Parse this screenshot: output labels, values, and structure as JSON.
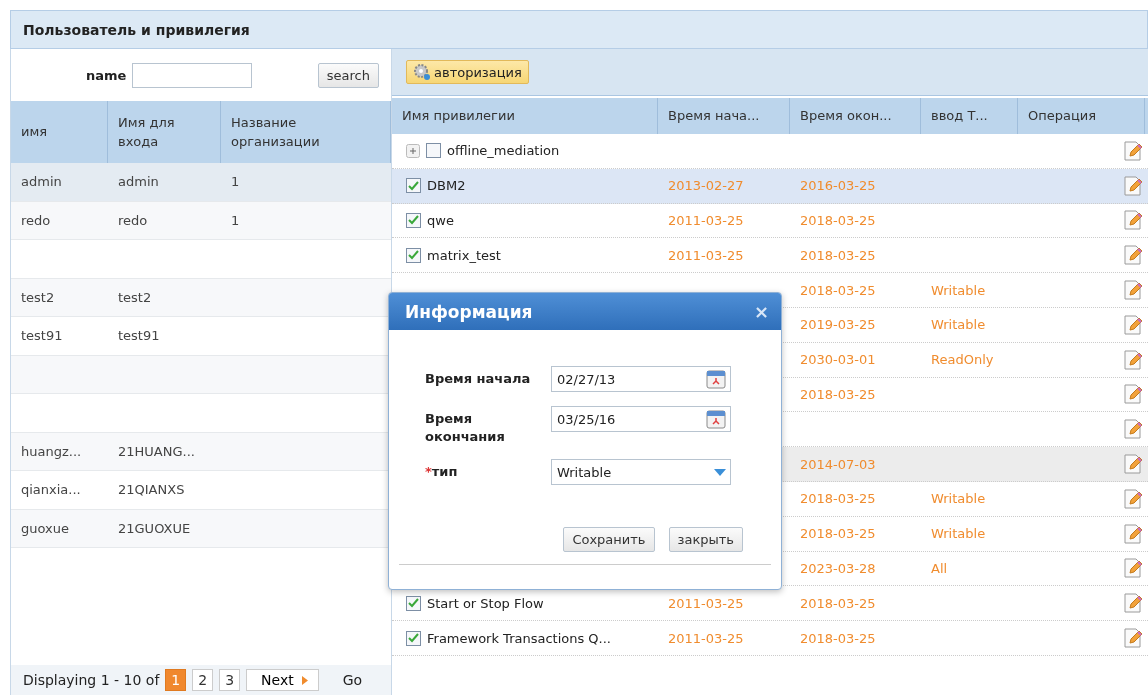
{
  "title": "Пользователь и привилегия",
  "search": {
    "label": "name",
    "button": "search"
  },
  "users": {
    "columns": [
      "имя",
      "Имя для входа",
      "Название организации"
    ],
    "rows": [
      {
        "cells": [
          "admin",
          "admin",
          "1"
        ],
        "selected": true
      },
      {
        "cells": [
          "redo",
          "redo",
          "1"
        ],
        "selected": false
      },
      {
        "cells": [],
        "selected": false
      },
      {
        "cells": [
          "test2",
          "test2"
        ],
        "selected": false
      },
      {
        "cells": [
          "test91",
          "test91"
        ],
        "selected": false
      },
      {
        "cells": [],
        "selected": false
      },
      {
        "cells": [],
        "selected": false
      },
      {
        "cells": [
          "huangz...",
          "21HUANG..."
        ],
        "selected": false
      },
      {
        "cells": [
          "qianxia...",
          "21QIANXS"
        ],
        "selected": false
      },
      {
        "cells": [
          "guoxue",
          "21GUOXUE"
        ],
        "selected": false
      }
    ]
  },
  "pager": {
    "summary": "Displaying 1 - 10 of",
    "pages": [
      {
        "label": "1",
        "selected": true
      },
      {
        "label": "2",
        "selected": false
      },
      {
        "label": "3",
        "selected": false
      }
    ],
    "next": "Next",
    "goto": "Go"
  },
  "toolbar": {
    "button": "авторизация"
  },
  "privileges": {
    "columns": [
      "Имя привилегии",
      "Время нача...",
      "Время окон...",
      "ввод Т...",
      "Операция"
    ],
    "rows": [
      {
        "name": "offline_mediation",
        "expandable": true,
        "checked": false,
        "selected": false
      },
      {
        "name": "DBM2",
        "checked": true,
        "start": "2013-02-27",
        "end": "2016-03-25",
        "selected": true
      },
      {
        "name": "qwe",
        "checked": true,
        "start": "2011-03-25",
        "end": "2018-03-25",
        "selected": false
      },
      {
        "name": "matrix_test",
        "checked": true,
        "start": "2011-03-25",
        "end": "2018-03-25",
        "selected": false
      },
      {
        "end": "2018-03-25",
        "type": "Writable",
        "selected": false
      },
      {
        "end": "2019-03-25",
        "type": "Writable",
        "selected": false
      },
      {
        "end": "2030-03-01",
        "type": "ReadOnly",
        "selected": false
      },
      {
        "end": "2018-03-25",
        "selected": false
      },
      {
        "selected": false
      },
      {
        "end": "2014-07-03",
        "selected": false,
        "hovered": true
      },
      {
        "end": "2018-03-25",
        "type": "Writable",
        "selected": false
      },
      {
        "end": "2018-03-25",
        "type": "Writable",
        "selected": false
      },
      {
        "end": "2023-03-28",
        "type": "All",
        "selected": false
      },
      {
        "name": "Start or Stop Flow",
        "checked": true,
        "start": "2011-03-25",
        "end": "2018-03-25",
        "selected": false
      },
      {
        "name": "Framework Transactions Q...",
        "checked": true,
        "start": "2011-03-25",
        "end": "2018-03-25",
        "selected": false
      }
    ]
  },
  "dialog": {
    "title": "Информация",
    "close": "×",
    "fields": [
      {
        "label": "Время начала",
        "kind": "date",
        "value": "02/27/13"
      },
      {
        "label": "Время окончания",
        "kind": "date",
        "value": "03/25/16"
      },
      {
        "label": "тип",
        "kind": "select",
        "value": "Writable",
        "required": true,
        "mark": "*"
      }
    ],
    "buttons": [
      "Сохранить",
      "закрыть"
    ]
  }
}
